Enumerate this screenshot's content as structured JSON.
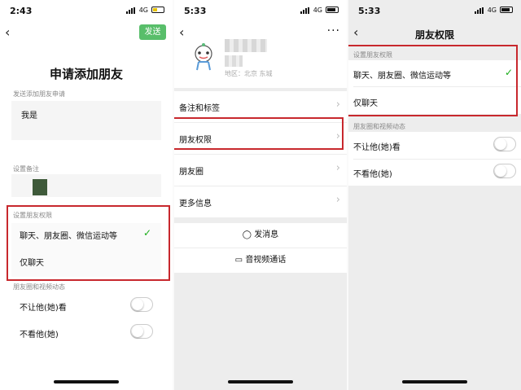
{
  "screen1": {
    "status": {
      "time": "2:43",
      "network": "4G"
    },
    "send_button": "发送",
    "title": "申请添加朋友",
    "request_label": "发送添加朋友申请",
    "request_text": "我是",
    "remark_label": "设置备注",
    "permission_label": "设置朋友权限",
    "option_all": "聊天、朋友圈、微信运动等",
    "option_chat_only": "仅聊天",
    "moments_label": "朋友圈和视频动态",
    "hide_my_moments": "不让他(她)看",
    "hide_their_moments": "不看他(她)"
  },
  "screen2": {
    "status": {
      "time": "5:33",
      "network": "4G"
    },
    "more_icon": "···",
    "region": "地区：北京 东城",
    "menu_items": [
      {
        "label": "备注和标签"
      },
      {
        "label": "朋友权限"
      },
      {
        "label": "朋友圈"
      },
      {
        "label": "更多信息"
      }
    ],
    "send_message": "发消息",
    "video_call": "音视频通话"
  },
  "screen3": {
    "status": {
      "time": "5:33",
      "network": "4G"
    },
    "title": "朋友权限",
    "permission_label": "设置朋友权限",
    "option_all": "聊天、朋友圈、微信运动等",
    "option_chat_only": "仅聊天",
    "moments_label": "朋友圈和视频动态",
    "hide_my_moments": "不让他(她)看",
    "hide_their_moments": "不看他(她)"
  },
  "colors": {
    "accent_green": "#58be6a",
    "check_green": "#1aad19",
    "highlight_red": "#c8282d",
    "battery_yellow": "#e6c200"
  }
}
